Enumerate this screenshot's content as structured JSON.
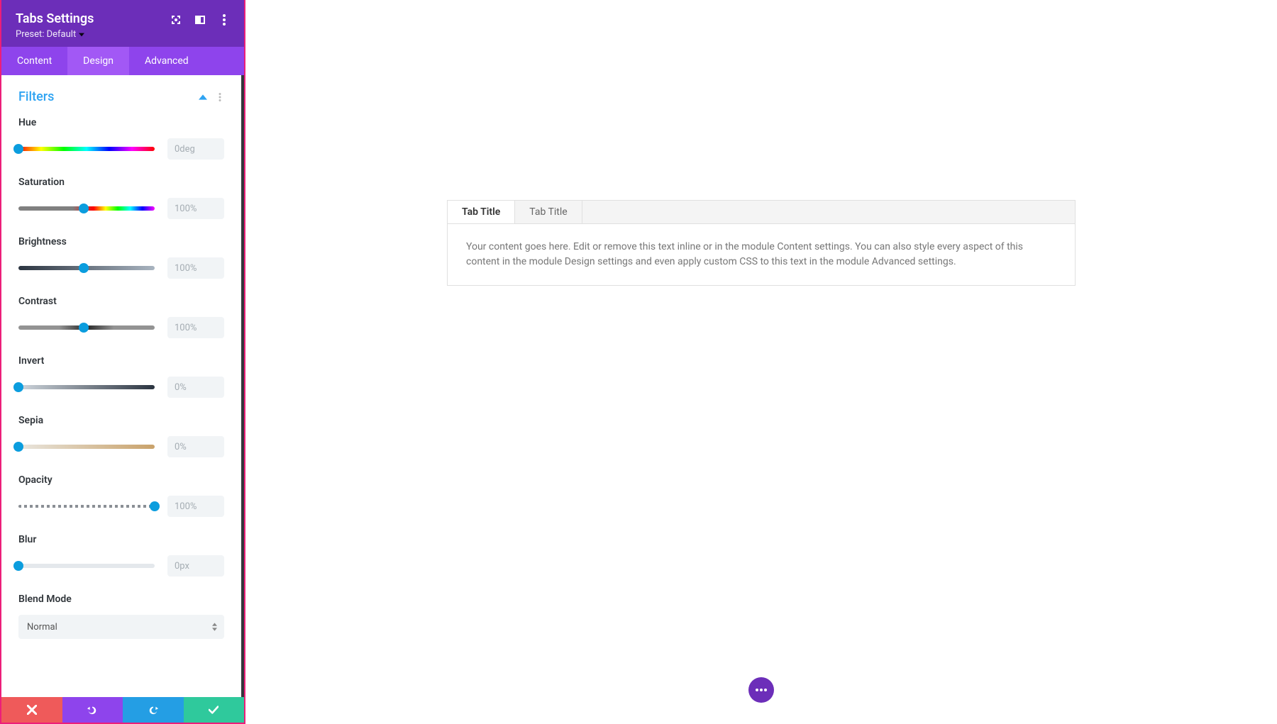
{
  "header": {
    "title": "Tabs Settings",
    "preset_label": "Preset: Default"
  },
  "tabs": {
    "content": "Content",
    "design": "Design",
    "advanced": "Advanced"
  },
  "section": {
    "title": "Filters"
  },
  "filters": {
    "hue": {
      "label": "Hue",
      "value": "0deg",
      "thumb_pct": 0
    },
    "saturation": {
      "label": "Saturation",
      "value": "100%",
      "thumb_pct": 48
    },
    "brightness": {
      "label": "Brightness",
      "value": "100%",
      "thumb_pct": 48
    },
    "contrast": {
      "label": "Contrast",
      "value": "100%",
      "thumb_pct": 48
    },
    "invert": {
      "label": "Invert",
      "value": "0%",
      "thumb_pct": 0
    },
    "sepia": {
      "label": "Sepia",
      "value": "0%",
      "thumb_pct": 0
    },
    "opacity": {
      "label": "Opacity",
      "value": "100%",
      "thumb_pct": 100
    },
    "blur": {
      "label": "Blur",
      "value": "0px",
      "thumb_pct": 0
    }
  },
  "blend": {
    "label": "Blend Mode",
    "value": "Normal"
  },
  "preview": {
    "tab1": "Tab Title",
    "tab2": "Tab Title",
    "body": "Your content goes here. Edit or remove this text inline or in the module Content settings. You can also style every aspect of this content in the module Design settings and even apply custom CSS to this text in the module Advanced settings."
  }
}
